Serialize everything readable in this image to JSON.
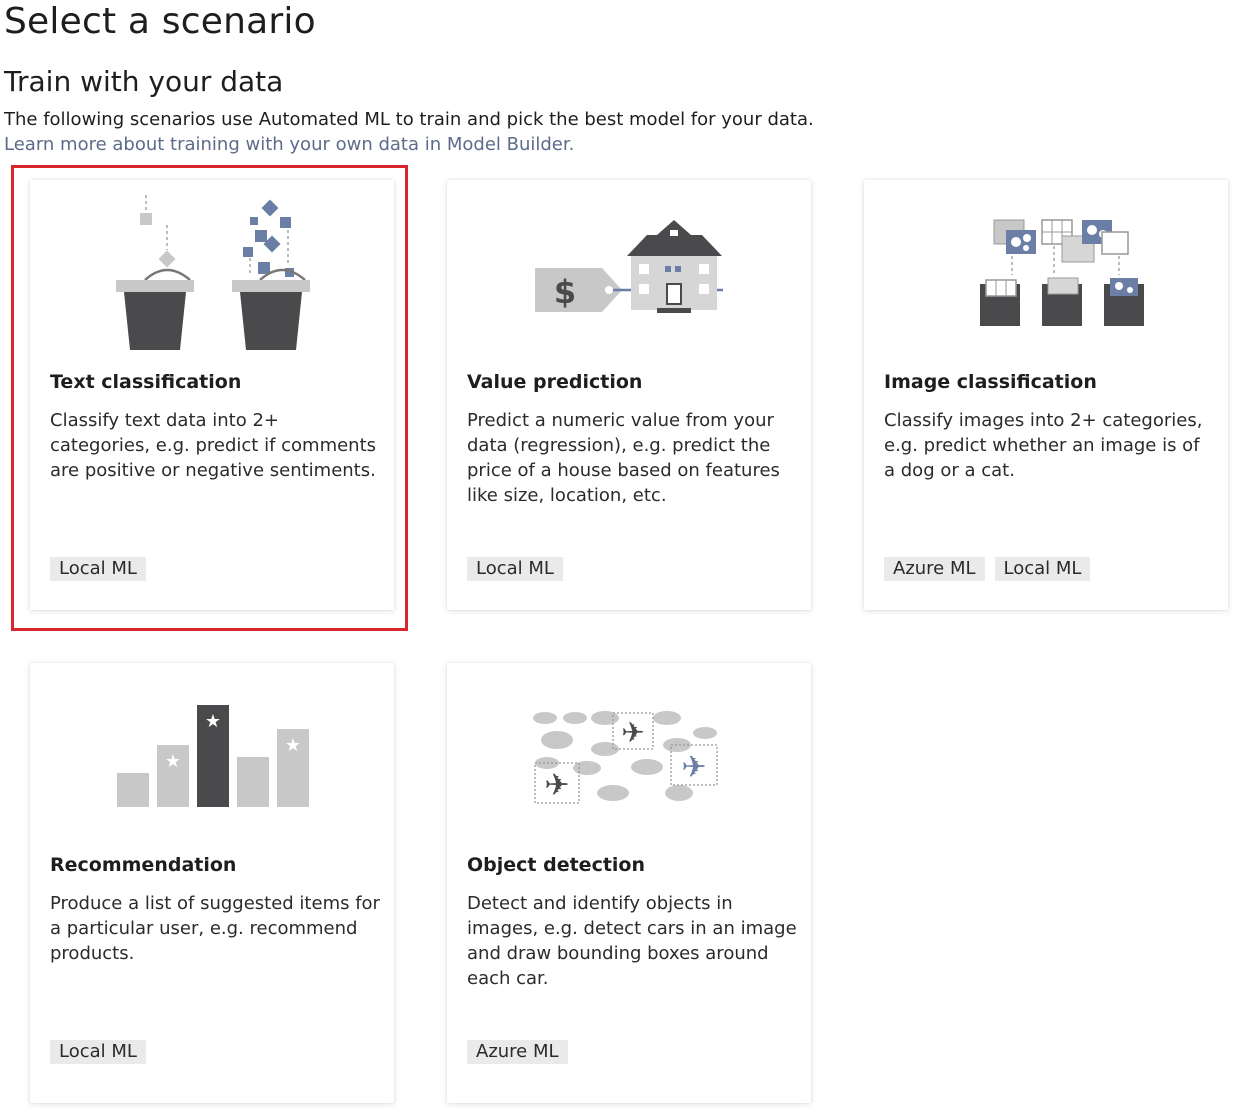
{
  "header": {
    "title": "Select a scenario",
    "section_title": "Train with your data",
    "description": "The following scenarios use Automated ML to train and pick the best model for your data.",
    "learn_more": "Learn more about training with your own data in Model Builder."
  },
  "colors": {
    "selection_border": "#d9262e",
    "link": "#5c6b89",
    "tag_bg": "#eaeaea",
    "icon_dark": "#4a4a4d",
    "icon_accent": "#6b7fa6",
    "icon_light": "#c8c8c8"
  },
  "scenarios": [
    {
      "icon": "buckets-icon",
      "title": "Text classification",
      "description": "Classify text data into 2+ categories, e.g. predict if comments are positive or negative sentiments.",
      "tags": [
        "Local ML"
      ],
      "selected": true
    },
    {
      "icon": "house-price-icon",
      "title": "Value prediction",
      "description": "Predict a numeric value from your data (regression), e.g. predict the price of a house based on features like size, location, etc.",
      "tags": [
        "Local ML"
      ],
      "selected": false
    },
    {
      "icon": "image-folders-icon",
      "title": "Image classification",
      "description": "Classify images into 2+ categories, e.g. predict whether an image is of a dog or a cat.",
      "tags": [
        "Azure ML",
        "Local ML"
      ],
      "selected": false
    },
    {
      "icon": "bar-stars-icon",
      "title": "Recommendation",
      "description": "Produce a list of suggested items for a particular user, e.g. recommend products.",
      "tags": [
        "Local ML"
      ],
      "selected": false
    },
    {
      "icon": "airplanes-clouds-icon",
      "title": "Object detection",
      "description": "Detect and identify objects in images, e.g. detect cars in an image and draw bounding boxes around each car.",
      "tags": [
        "Azure ML"
      ],
      "selected": false
    }
  ]
}
